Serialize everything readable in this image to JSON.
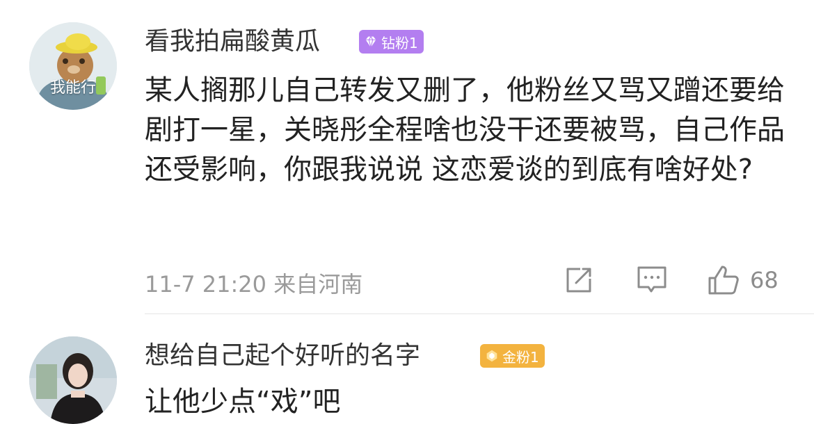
{
  "comments": [
    {
      "avatar_text": "我能行",
      "username": "看我拍扁酸黄瓜",
      "badge": "钻粉1",
      "text": "某人搁那儿自己转发又删了，他粉丝又骂又蹭还要给剧打一星，关晓彤全程啥也没干还要被骂，自己作品还受影响，你跟我说说 这恋爱谈的到底有啥好处?",
      "time": "11-7 21:20",
      "location": "来自河南",
      "like_count": "68"
    },
    {
      "username": "想给自己起个好听的名字",
      "badge": "金粉1",
      "text": "让他少点“戏”吧"
    }
  ],
  "colors": {
    "badge_diamond": "#b37ef0",
    "badge_gold": "#f3b33f",
    "meta_gray": "#9a9a9a"
  },
  "icons": [
    "share-icon",
    "comment-icon",
    "like-icon",
    "diamond-icon",
    "gold-badge-icon"
  ]
}
